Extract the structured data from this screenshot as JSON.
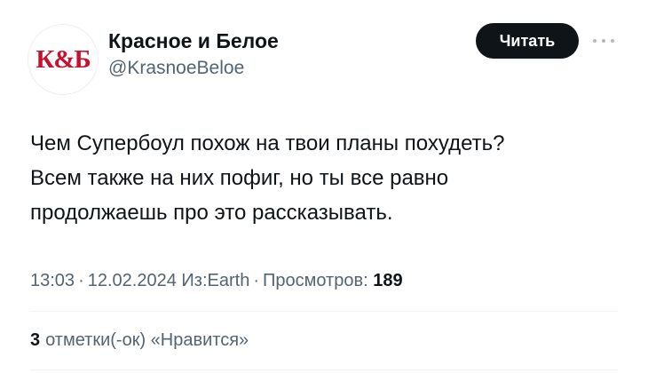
{
  "account": {
    "display_name": "Красное и Белое",
    "handle": "@KrasnoeBeloe",
    "avatar_text": "К&Б",
    "avatar_color": "#c8102e"
  },
  "header": {
    "follow_label": "Читать",
    "more_icon": "more-horizontal-icon"
  },
  "tweet": {
    "lines": [
      "Чем Супербоул похож на твои планы похудеть?",
      "Всем также на них пофиг, но ты все равно",
      "продолжаешь про это рассказывать."
    ]
  },
  "meta": {
    "time": "13:03",
    "separator": "·",
    "date": "12.02.2024",
    "source": "Из:Earth",
    "views_label": "Просмотров:",
    "views_count": "189"
  },
  "likes": {
    "count": "3",
    "label": "отметки(-ок) «Нравится»"
  }
}
